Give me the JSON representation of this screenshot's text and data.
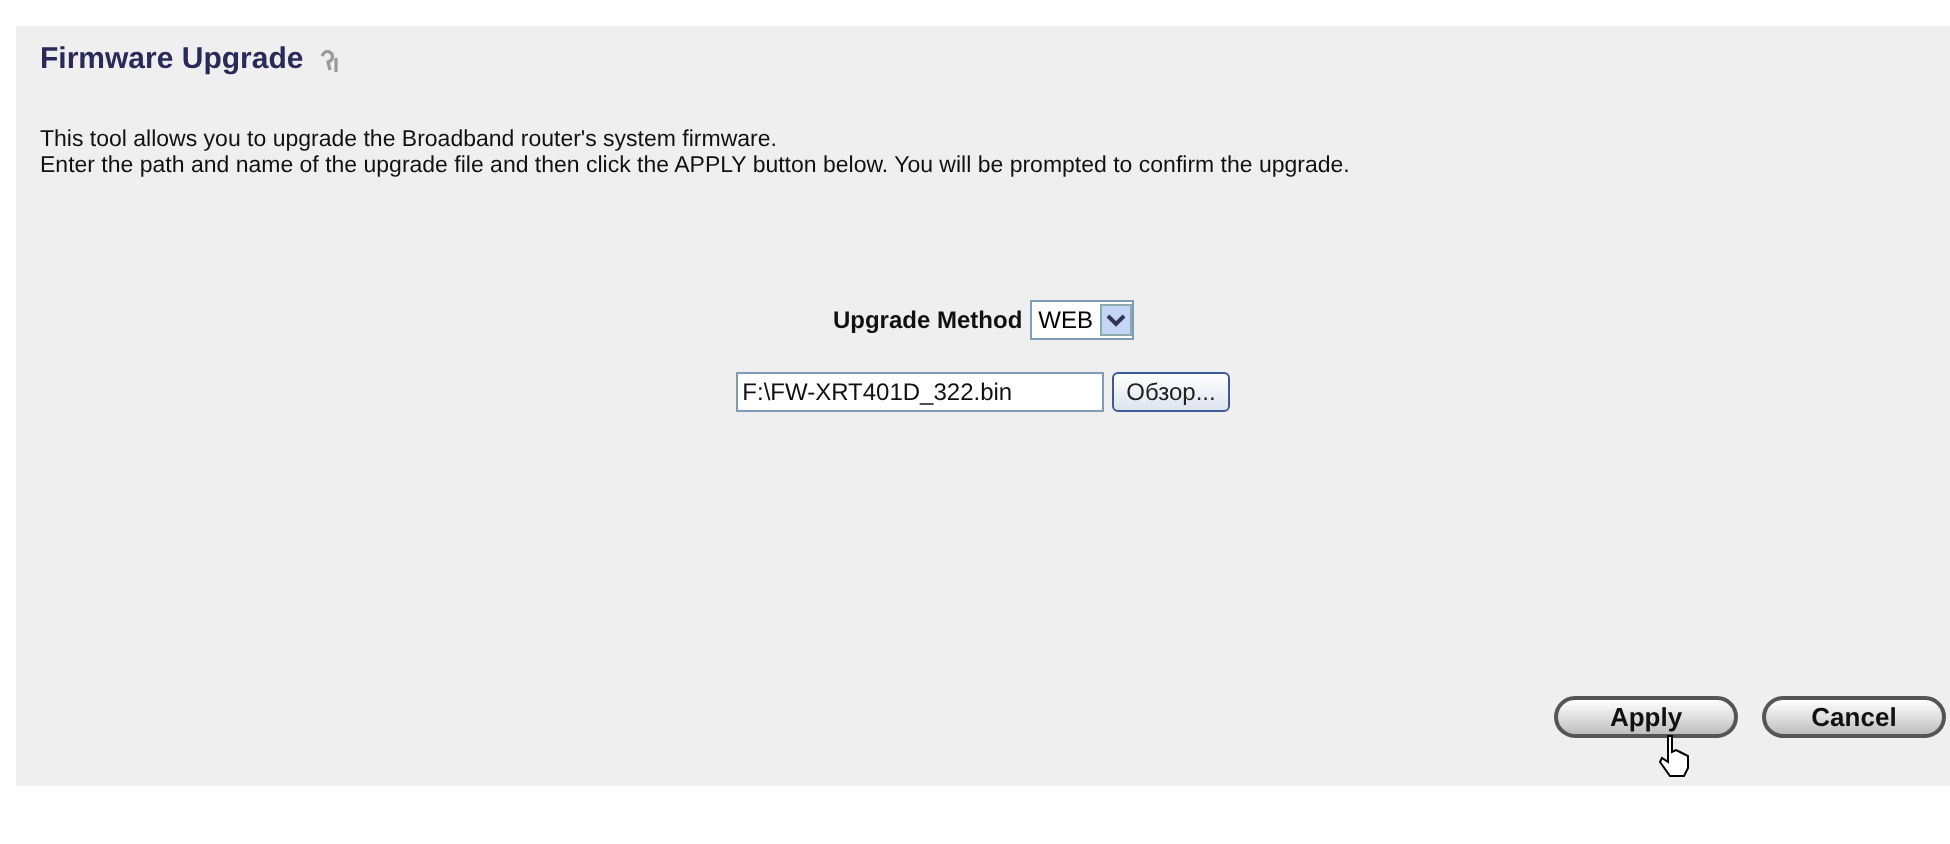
{
  "title": "Firmware Upgrade",
  "description": [
    "This tool allows you to upgrade the Broadband router's system firmware.",
    "Enter the path and name of the upgrade file and then click the APPLY button below. You will be prompted to confirm the upgrade."
  ],
  "upgrade_method": {
    "label": "Upgrade Method",
    "value": "WEB"
  },
  "file_field": {
    "value": "F:\\FW-XRT401D_322.bin",
    "browse_button": "Обзор..."
  },
  "buttons": [
    "Apply",
    "Cancel"
  ]
}
